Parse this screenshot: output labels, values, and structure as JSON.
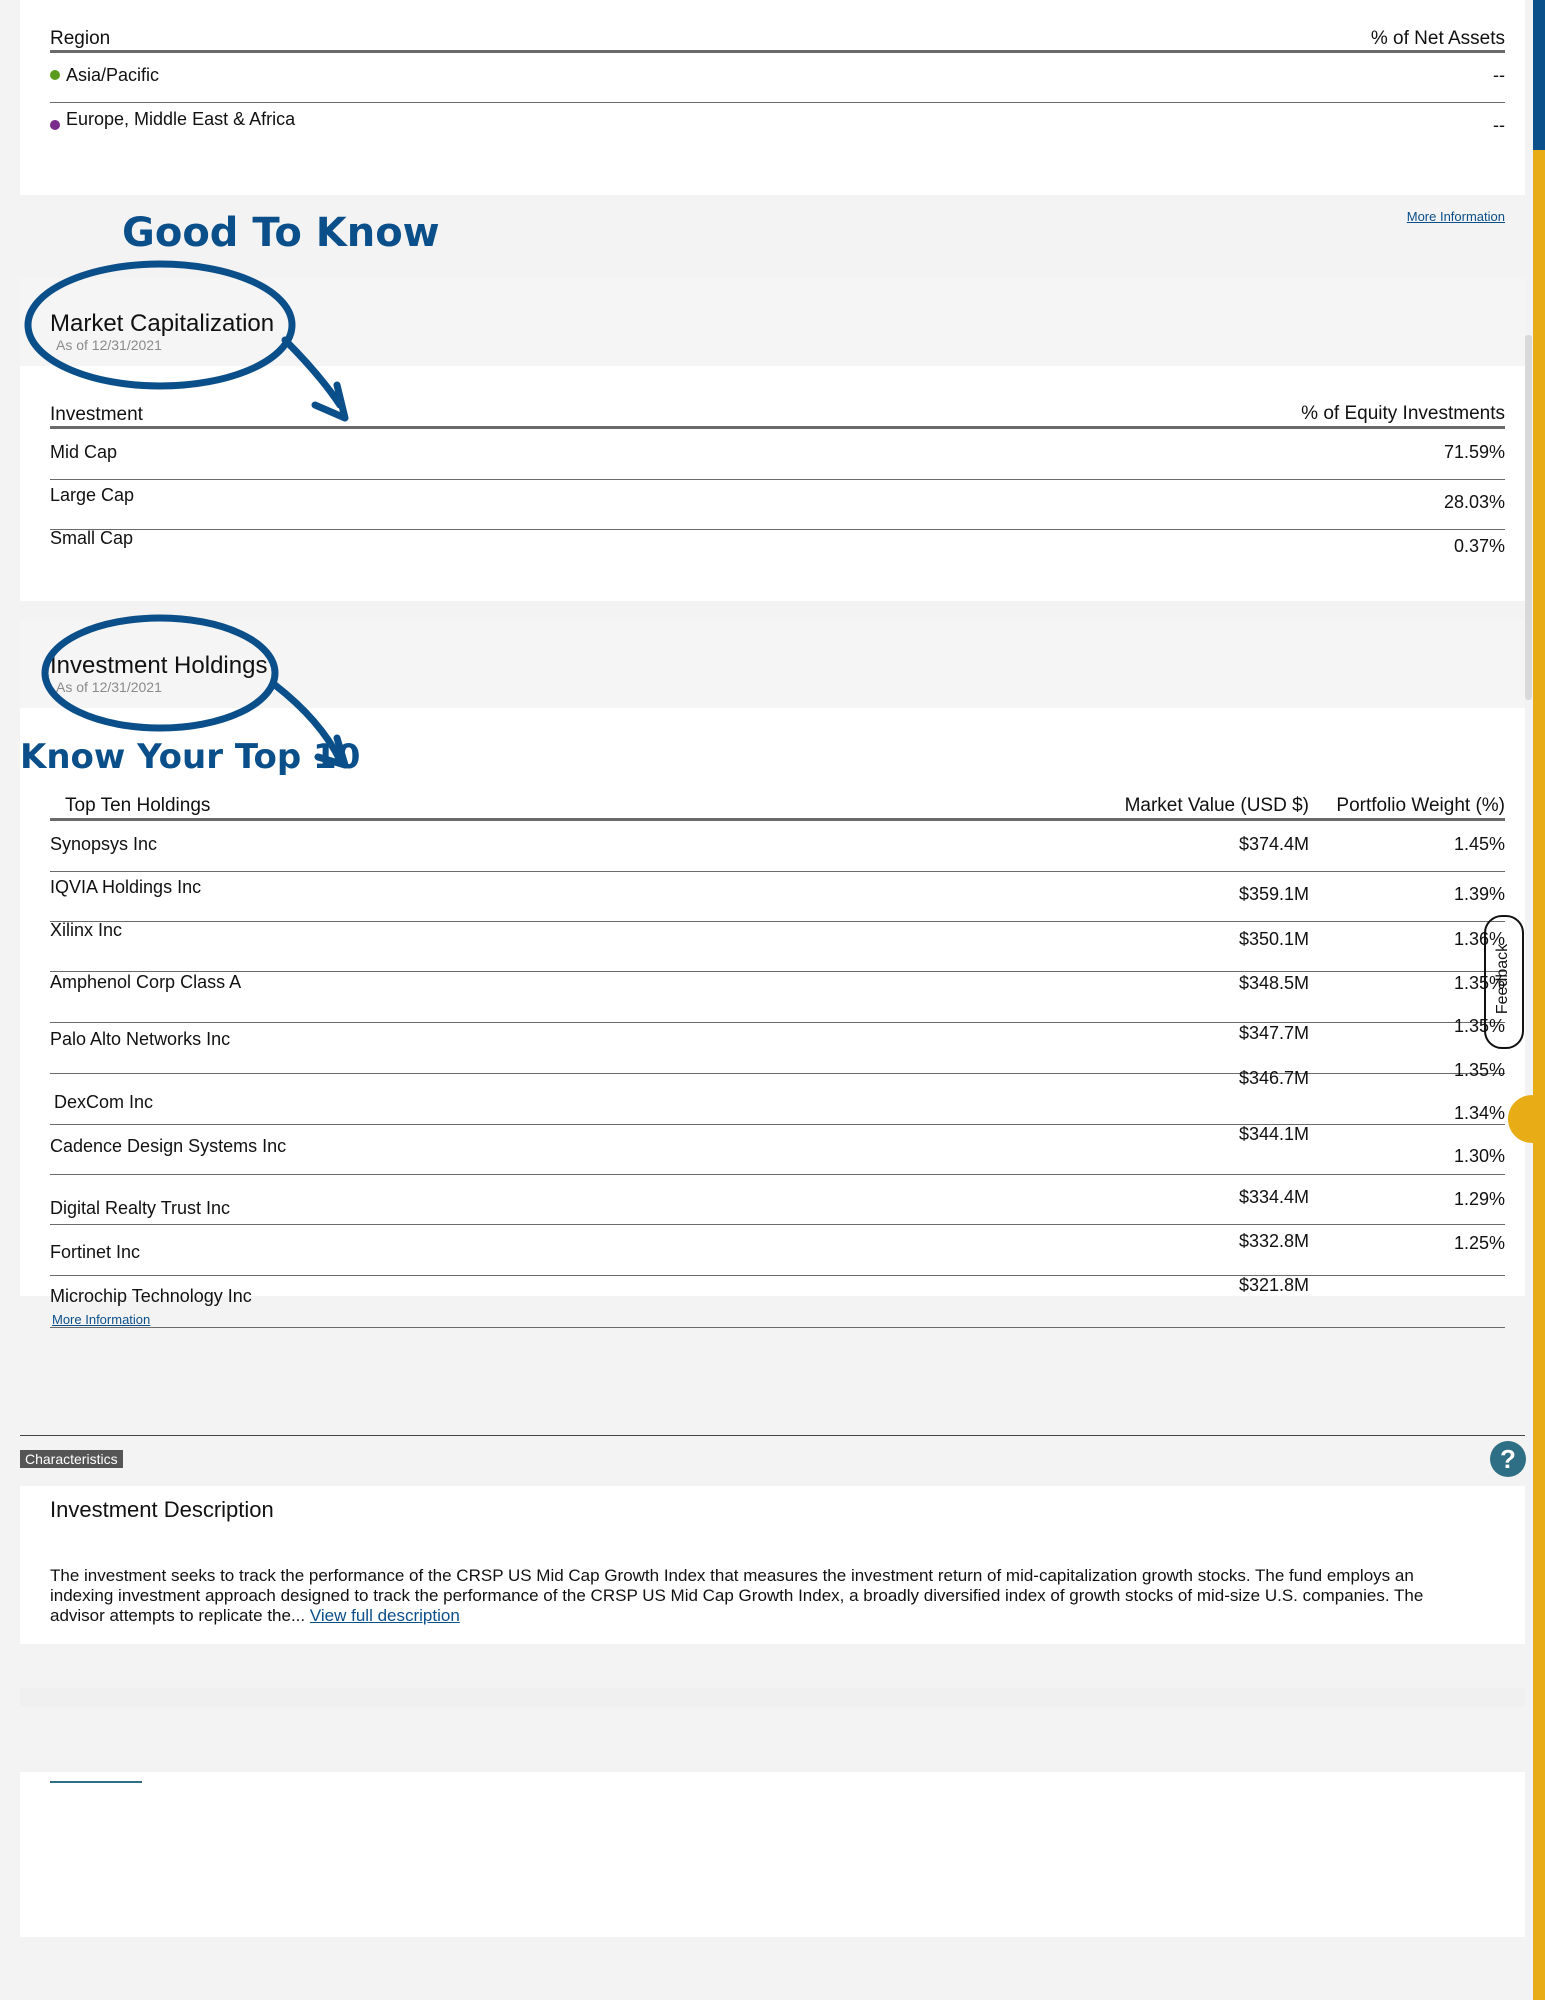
{
  "region_table": {
    "header_left": "Region",
    "header_right": "% of Net Assets",
    "rows": [
      {
        "label": "Asia/Pacific",
        "value": "--",
        "dot_color": "#5a9b1e"
      },
      {
        "label": "Europe, Middle East & Africa",
        "value": "--",
        "dot_color": "#7a2a8a"
      }
    ]
  },
  "good_to_know": {
    "annotation": "Good To Know",
    "more_information": "More Information"
  },
  "market_cap": {
    "title": "Market Capitalization",
    "as_of": "As of 12/31/2021",
    "header_left": "Investment",
    "header_right": "% of Equity Investments",
    "rows": [
      {
        "label": "Mid Cap",
        "value": "71.59%"
      },
      {
        "label": "Large Cap",
        "value": "28.03%"
      },
      {
        "label": "Small Cap",
        "value": "0.37%"
      }
    ]
  },
  "holdings": {
    "title": "Investment Holdings",
    "as_of": "As of 12/31/2021",
    "annotation": "Know Your Top 10",
    "col_name": "Top Ten Holdings",
    "col_value": "Market Value (USD $)",
    "col_weight": "Portfolio Weight (%)",
    "rows": [
      {
        "name": "Synopsys Inc",
        "value": "$374.4M",
        "weight": "1.45%"
      },
      {
        "name": "IQVIA Holdings Inc",
        "value": "$359.1M",
        "weight": "1.39%"
      },
      {
        "name": "Xilinx Inc",
        "value": "$350.1M",
        "weight": "1.36%"
      },
      {
        "name": "Amphenol Corp Class A",
        "value": "$348.5M",
        "weight": "1.35%"
      },
      {
        "name": "Palo Alto Networks Inc",
        "value": "$347.7M",
        "weight": "1.35%"
      },
      {
        "name": "DexCom Inc",
        "value": "$346.7M",
        "weight": "1.35%"
      },
      {
        "name": "Cadence Design Systems Inc",
        "value": "$344.1M",
        "weight": "1.34%"
      },
      {
        "name": "Digital Realty Trust Inc",
        "value": "$334.4M",
        "weight": "1.30%"
      },
      {
        "name": "Fortinet Inc",
        "value": "$332.8M",
        "weight": "1.29%"
      },
      {
        "name": "Microchip Technology Inc",
        "value": "$321.8M",
        "weight": "1.25%"
      }
    ],
    "more_information": "More Information"
  },
  "feedback_label": "Feedback",
  "characteristics_tab": "Characteristics",
  "help_icon_glyph": "?",
  "description": {
    "title": "Investment Description",
    "body": "The investment seeks to track the performance of the CRSP US Mid Cap Growth Index that measures the investment return of mid-capitalization growth stocks. The fund employs an indexing investment approach designed to track the performance of the CRSP US Mid Cap Growth Index, a broadly diversified index of growth stocks of mid-size U.S. companies. The advisor attempts to replicate the...",
    "view_full": "View full description"
  },
  "colors": {
    "annotation_blue": "#0b4f8a",
    "accent_yellow": "#e8ac16",
    "scroll_blue": "#0b4f8a",
    "help_teal": "#2f6f85"
  }
}
